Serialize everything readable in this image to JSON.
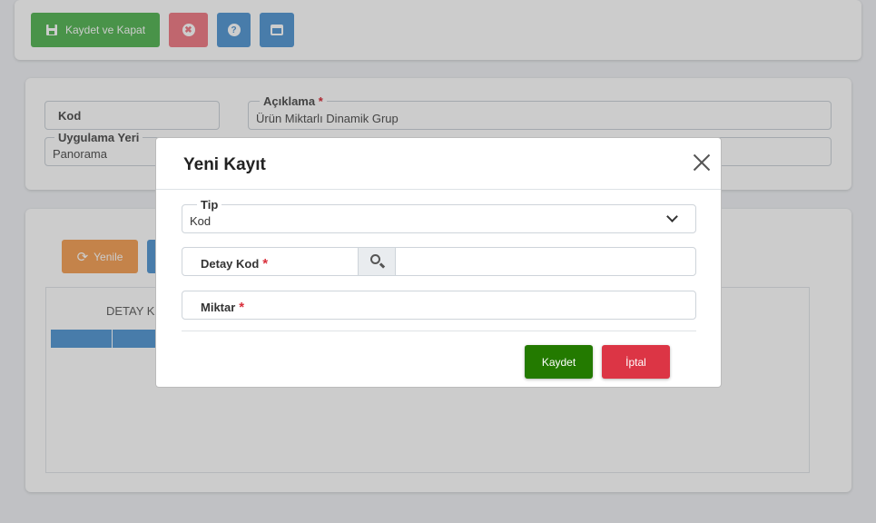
{
  "toolbar": {
    "save_close_label": "Kaydet ve Kapat",
    "close_icon_glyph": "✖",
    "help_icon_glyph": "?"
  },
  "form": {
    "kod_label": "Kod",
    "kod_value": "",
    "aciklama_label": "Açıklama",
    "aciklama_value": "Ürün Miktarlı Dinamik Grup",
    "uygulama_yeri_label": "Uygulama Yeri",
    "uygulama_yeri_value": "Panorama",
    "required_marker": "*"
  },
  "grid": {
    "refresh_label": "Yenile",
    "refresh_icon_glyph": "⟳",
    "column_header_partial": "DETAY K"
  },
  "modal": {
    "title": "Yeni Kayıt",
    "tip_label": "Tip",
    "tip_value": "Kod",
    "detay_kod_label": "Detay Kod",
    "detay_kod_value": "",
    "miktar_label": "Miktar",
    "miktar_value": "",
    "required_marker": "*",
    "save_label": "Kaydet",
    "cancel_label": "İptal"
  },
  "colors": {
    "save_close": "#5cb85c",
    "danger": "#dc3545",
    "primary": "#5b9bd5",
    "warning": "#f5a45d",
    "save_green": "#237a00"
  }
}
